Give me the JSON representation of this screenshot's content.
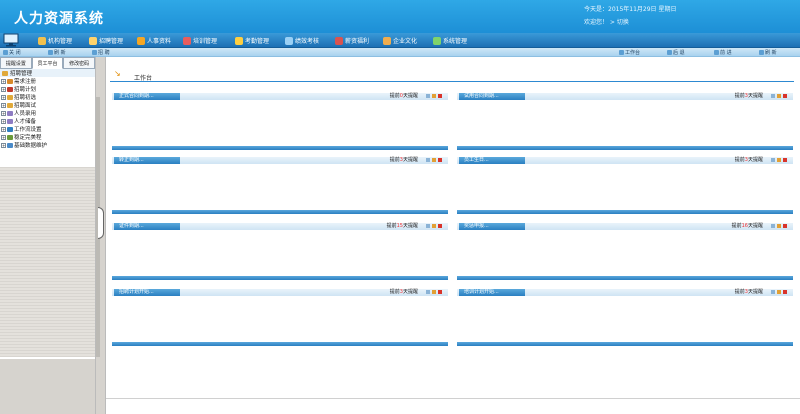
{
  "header": {
    "title": "人力资源系统",
    "date_text": "今天是：2015年11月29日 星期日",
    "welcome_text": "欢迎您！ > 切换"
  },
  "nav": {
    "items": [
      {
        "label": "机构管理",
        "icon": "building-icon",
        "color": "#f2c14e"
      },
      {
        "label": "招聘管理",
        "icon": "handshake-icon",
        "color": "#ffd36b"
      },
      {
        "label": "人事资料",
        "icon": "people-icon",
        "color": "#f5a623"
      },
      {
        "label": "培训管理",
        "icon": "book-icon",
        "color": "#e85d5d"
      },
      {
        "label": "考勤管理",
        "icon": "clock-icon",
        "color": "#ffcf40"
      },
      {
        "label": "绩效考核",
        "icon": "chart-icon",
        "color": "#9ad0f5"
      },
      {
        "label": "薪资福利",
        "icon": "money-icon",
        "color": "#d9534f"
      },
      {
        "label": "企业文化",
        "icon": "culture-icon",
        "color": "#f0ad4e"
      },
      {
        "label": "系统管理",
        "icon": "settings-icon",
        "color": "#7fd36b"
      }
    ]
  },
  "toolbar": {
    "left": [
      "关 闭",
      "刷 新"
    ],
    "module_label": "招 聘",
    "right": [
      "工作台",
      "后 退",
      "前 进",
      "刷 新"
    ]
  },
  "sidebar": {
    "tabs": [
      "提醒设置",
      "员工平台",
      "修改密码"
    ],
    "root_label": "招聘管理",
    "items": [
      {
        "label": "需求注册",
        "icon": "pencil-icon"
      },
      {
        "label": "招聘计划",
        "icon": "calendar-icon"
      },
      {
        "label": "招聘初选",
        "icon": "folder-icon"
      },
      {
        "label": "招聘面试",
        "icon": "folder-icon"
      },
      {
        "label": "人员录用",
        "icon": "person-icon"
      },
      {
        "label": "人才储备",
        "icon": "person-icon"
      },
      {
        "label": "工作流设置",
        "icon": "workflow-icon"
      },
      {
        "label": "稳定完美程",
        "icon": "gear-icon"
      },
      {
        "label": "基础数据维护",
        "icon": "database-icon"
      }
    ]
  },
  "main": {
    "workbench_title": "工作台",
    "panels": [
      {
        "title": "正式合同到期...",
        "remind_prefix": "提前",
        "remind_days": "0",
        "remind_suffix": "天提醒"
      },
      {
        "title": "试用合同到期...",
        "remind_prefix": "提前",
        "remind_days": "3",
        "remind_suffix": "天提醒"
      },
      {
        "title": "转正到期...",
        "remind_prefix": "提前",
        "remind_days": "3",
        "remind_suffix": "天提醒"
      },
      {
        "title": "员工生日...",
        "remind_prefix": "提前",
        "remind_days": "3",
        "remind_suffix": "天提醒"
      },
      {
        "title": "证件到期...",
        "remind_prefix": "提前",
        "remind_days": "15",
        "remind_suffix": "天提醒"
      },
      {
        "title": "奖惩申报...",
        "remind_prefix": "提前",
        "remind_days": "16",
        "remind_suffix": "天提醒"
      },
      {
        "title": "招聘计划开始...",
        "remind_prefix": "提前",
        "remind_days": "3",
        "remind_suffix": "天提醒"
      },
      {
        "title": "培训计划开始...",
        "remind_prefix": "提前",
        "remind_days": "3",
        "remind_suffix": "天提醒"
      }
    ]
  }
}
